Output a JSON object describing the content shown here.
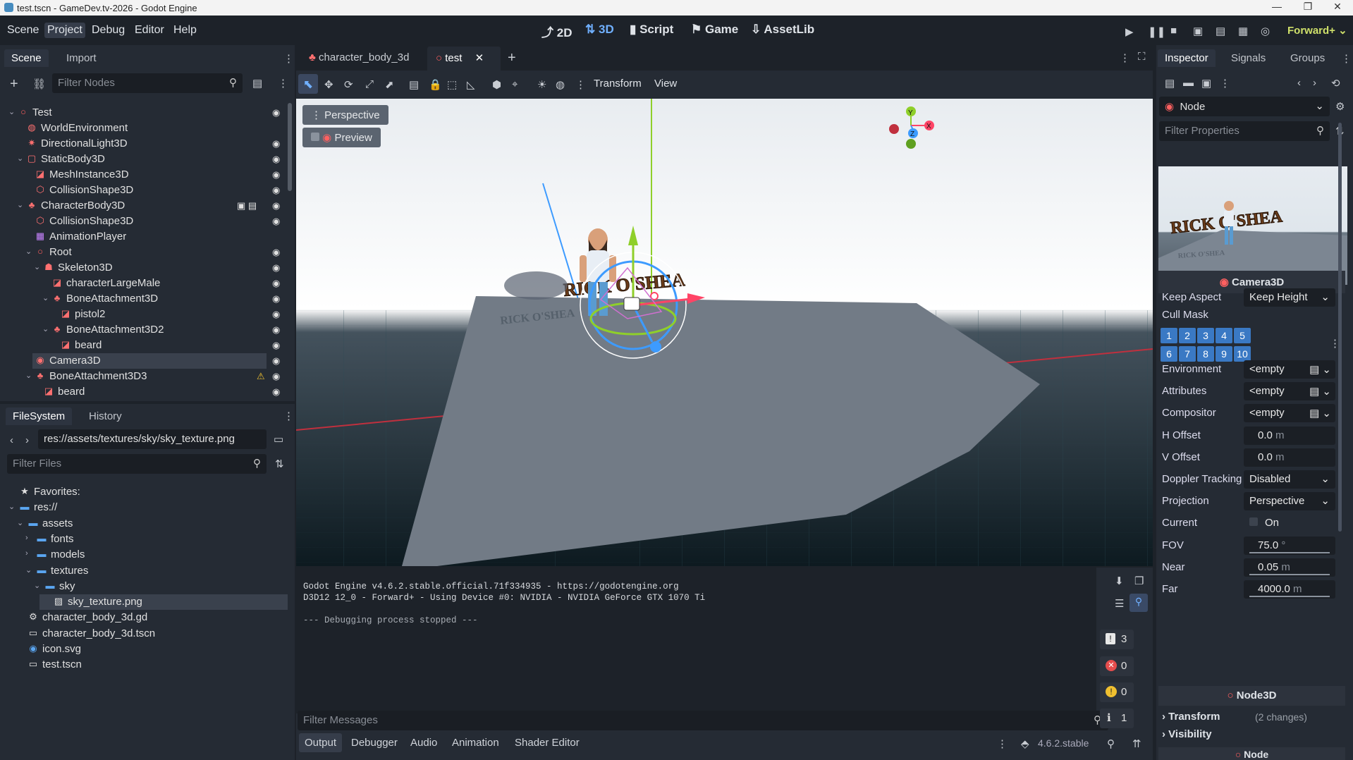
{
  "window": {
    "title": "test.tscn - GameDev.tv-2026 - Godot Engine",
    "min": "—",
    "max": "❐",
    "close": "✕"
  },
  "menu": [
    "Scene",
    "Project",
    "Debug",
    "Editor",
    "Help"
  ],
  "modes": [
    {
      "label": "2D",
      "icon": "⤴"
    },
    {
      "label": "3D",
      "icon": "⇅"
    },
    {
      "label": "Script",
      "icon": "▮"
    },
    {
      "label": "Game",
      "icon": "⚑"
    },
    {
      "label": "AssetLib",
      "icon": "⇩"
    }
  ],
  "renderer": "Forward+",
  "scene_dock": {
    "tabs": [
      "Scene",
      "Import"
    ],
    "filter_placeholder": "Filter Nodes",
    "nodes": [
      {
        "name": "Test",
        "depth": 0,
        "arrow": "⌄",
        "icon": "○",
        "color": "#ff5f5f",
        "eye": true
      },
      {
        "name": "WorldEnvironment",
        "depth": 1,
        "icon": "◍",
        "color": "#ff7070",
        "eye": false
      },
      {
        "name": "DirectionalLight3D",
        "depth": 1,
        "icon": "✷",
        "color": "#ff7070",
        "eye": true
      },
      {
        "name": "StaticBody3D",
        "depth": 1,
        "arrow": "⌄",
        "icon": "▢",
        "color": "#ff7070",
        "eye": true
      },
      {
        "name": "MeshInstance3D",
        "depth": 2,
        "icon": "◪",
        "color": "#ff7070",
        "eye": true
      },
      {
        "name": "CollisionShape3D",
        "depth": 2,
        "icon": "⬡",
        "color": "#ff7070",
        "eye": true
      },
      {
        "name": "CharacterBody3D",
        "depth": 1,
        "arrow": "⌄",
        "icon": "♣",
        "color": "#ff7070",
        "eye": true,
        "extra": "▣ ▤"
      },
      {
        "name": "CollisionShape3D",
        "depth": 2,
        "icon": "⬡",
        "color": "#ff7070",
        "eye": true
      },
      {
        "name": "AnimationPlayer",
        "depth": 2,
        "icon": "▦",
        "color": "#c884ff",
        "eye": false
      },
      {
        "name": "Root",
        "depth": 2,
        "arrow": "⌄",
        "icon": "○",
        "color": "#ff5f5f",
        "eye": true
      },
      {
        "name": "Skeleton3D",
        "depth": 3,
        "arrow": "⌄",
        "icon": "☗",
        "color": "#ff7070",
        "eye": true
      },
      {
        "name": "characterLargeMale",
        "depth": 4,
        "icon": "◪",
        "color": "#ff7070",
        "eye": true
      },
      {
        "name": "BoneAttachment3D",
        "depth": 4,
        "arrow": "⌄",
        "icon": "♣",
        "color": "#ff7070",
        "eye": true
      },
      {
        "name": "pistol2",
        "depth": 5,
        "icon": "◪",
        "color": "#ff7070",
        "eye": true
      },
      {
        "name": "BoneAttachment3D2",
        "depth": 4,
        "arrow": "⌄",
        "icon": "♣",
        "color": "#ff7070",
        "eye": true
      },
      {
        "name": "beard",
        "depth": 5,
        "icon": "◪",
        "color": "#ff7070",
        "eye": true
      },
      {
        "name": "Camera3D",
        "depth": 2,
        "icon": "◉",
        "color": "#ff7070",
        "eye": true,
        "selected": true
      },
      {
        "name": "BoneAttachment3D3",
        "depth": 2,
        "arrow": "⌄",
        "icon": "♣",
        "color": "#ff7070",
        "eye": true,
        "warn": "⚠"
      },
      {
        "name": "beard",
        "depth": 3,
        "icon": "◪",
        "color": "#ff7070",
        "eye": true
      }
    ]
  },
  "fs_dock": {
    "tabs": [
      "FileSystem",
      "History"
    ],
    "path": "res://assets/textures/sky/sky_texture.png",
    "filter_placeholder": "Filter Files",
    "items": [
      {
        "name": "Favorites:",
        "depth": 0,
        "icon": "★",
        "color": "#e0e0e0"
      },
      {
        "name": "res://",
        "depth": 0,
        "arrow": "⌄",
        "icon": "▬",
        "color": "#5aa5f0"
      },
      {
        "name": "assets",
        "depth": 1,
        "arrow": "⌄",
        "icon": "▬",
        "color": "#5aa5f0"
      },
      {
        "name": "fonts",
        "depth": 2,
        "arrow": "›",
        "icon": "▬",
        "color": "#5aa5f0"
      },
      {
        "name": "models",
        "depth": 2,
        "arrow": "›",
        "icon": "▬",
        "color": "#5aa5f0"
      },
      {
        "name": "textures",
        "depth": 2,
        "arrow": "⌄",
        "icon": "▬",
        "color": "#5aa5f0"
      },
      {
        "name": "sky",
        "depth": 3,
        "arrow": "⌄",
        "icon": "▬",
        "color": "#5aa5f0"
      },
      {
        "name": "sky_texture.png",
        "depth": 4,
        "icon": "▨",
        "color": "#e0e0e0",
        "selected": true
      },
      {
        "name": "character_body_3d.gd",
        "depth": 1,
        "icon": "⚙",
        "color": "#e0e0e0"
      },
      {
        "name": "character_body_3d.tscn",
        "depth": 1,
        "icon": "▭",
        "color": "#e0e0e0"
      },
      {
        "name": "icon.svg",
        "depth": 1,
        "icon": "◉",
        "color": "#5aa5f0"
      },
      {
        "name": "test.tscn",
        "depth": 1,
        "icon": "▭",
        "color": "#e0e0e0"
      }
    ]
  },
  "editor_tabs": [
    {
      "label": "character_body_3d",
      "icon": "♣",
      "active": false
    },
    {
      "label": "test",
      "icon": "○",
      "active": true
    }
  ],
  "viewport_toolbar": {
    "transform": "Transform",
    "view": "View"
  },
  "viewport": {
    "perspective": "Perspective",
    "preview": "Preview",
    "gizmo": {
      "x": "X",
      "y": "Y",
      "z": "Z"
    },
    "sign_text": "RICK O'SHEA",
    "ground_text": "RICK O'SHEA"
  },
  "output": {
    "lines": [
      "Godot Engine v4.6.2.stable.official.71f334935 - https://godotengine.org",
      "D3D12 12_0 - Forward+ - Using Device #0: NVIDIA - NVIDIA GeForce GTX 1070 Ti",
      "",
      "--- Debugging process stopped ---"
    ],
    "filter_placeholder": "Filter Messages",
    "counts": {
      "messages": "3",
      "errors": "0",
      "warnings": "0",
      "editor": "1"
    }
  },
  "bottom_tabs": [
    "Output",
    "Debugger",
    "Audio",
    "Animation",
    "Shader Editor"
  ],
  "version": "4.6.2.stable",
  "inspector": {
    "tabs": [
      "Inspector",
      "Signals",
      "Groups"
    ],
    "node": "Node",
    "filter_placeholder": "Filter Properties",
    "section": "Camera3D",
    "keep_aspect": {
      "label": "Keep Aspect",
      "value": "Keep Height"
    },
    "cull_mask": {
      "label": "Cull Mask",
      "layers": [
        "1",
        "2",
        "3",
        "4",
        "5",
        "6",
        "7",
        "8",
        "9",
        "10"
      ]
    },
    "props": [
      {
        "label": "Environment",
        "value": "<empty"
      },
      {
        "label": "Attributes",
        "value": "<empty"
      },
      {
        "label": "Compositor",
        "value": "<empty"
      },
      {
        "label": "H Offset",
        "value": "0.0",
        "unit": "m"
      },
      {
        "label": "V Offset",
        "value": "0.0",
        "unit": "m"
      },
      {
        "label": "Doppler Tracking",
        "value": "Disabled"
      },
      {
        "label": "Projection",
        "value": "Perspective"
      },
      {
        "label": "Current",
        "value": "On"
      },
      {
        "label": "FOV",
        "value": "75.0",
        "unit": "°"
      },
      {
        "label": "Near",
        "value": "0.05",
        "unit": "m"
      },
      {
        "label": "Far",
        "value": "4000.0",
        "unit": "m"
      }
    ],
    "node3d": "Node3D",
    "transform": "Transform",
    "transform_changes": "(2 changes)",
    "visibility": "Visibility"
  }
}
